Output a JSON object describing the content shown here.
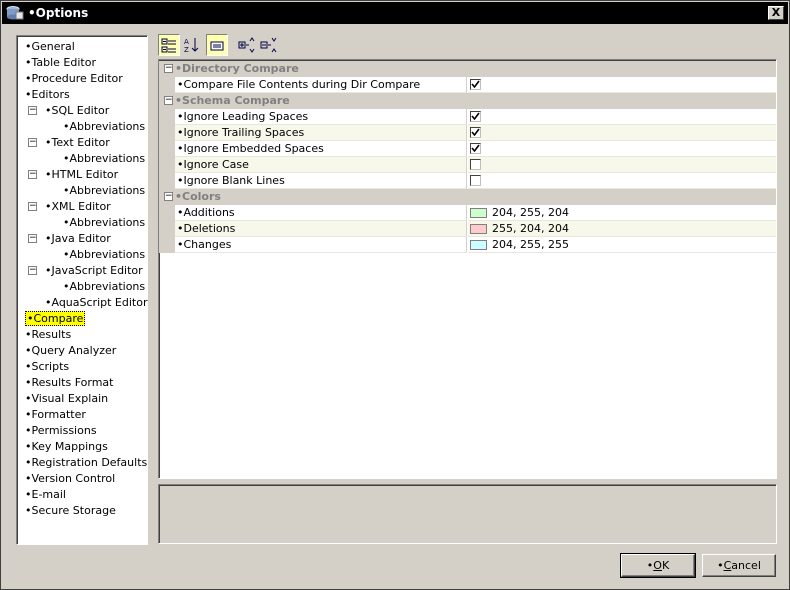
{
  "window": {
    "title": "•Options",
    "close_label": "X"
  },
  "tree": [
    {
      "label": "•General"
    },
    {
      "label": "•Table Editor"
    },
    {
      "label": "•Procedure Editor"
    },
    {
      "label": "•Editors"
    },
    {
      "label": "•SQL Editor",
      "expander": "−"
    },
    {
      "label": "•Abbreviations"
    },
    {
      "label": "•Text Editor",
      "expander": "−"
    },
    {
      "label": "•Abbreviations"
    },
    {
      "label": "•HTML Editor",
      "expander": "−"
    },
    {
      "label": "•Abbreviations"
    },
    {
      "label": "•XML Editor",
      "expander": "−"
    },
    {
      "label": "•Abbreviations"
    },
    {
      "label": "•Java Editor",
      "expander": "−"
    },
    {
      "label": "•Abbreviations"
    },
    {
      "label": "•JavaScript Editor",
      "expander": "−"
    },
    {
      "label": "•Abbreviations"
    },
    {
      "label": "•AquaScript Editor"
    },
    {
      "label": "•Compare",
      "selected": true
    },
    {
      "label": "•Results"
    },
    {
      "label": "•Query Analyzer"
    },
    {
      "label": "•Scripts"
    },
    {
      "label": "•Results Format"
    },
    {
      "label": "•Visual Explain"
    },
    {
      "label": "•Formatter"
    },
    {
      "label": "•Permissions"
    },
    {
      "label": "•Key Mappings"
    },
    {
      "label": "•Registration Defaults"
    },
    {
      "label": "•Version Control"
    },
    {
      "label": "•E-mail"
    },
    {
      "label": "•Secure Storage"
    }
  ],
  "toolbar": {
    "categorized": "categorized-view-icon",
    "alphabetical": "sort-alphabetical-icon",
    "description": "show-description-icon",
    "expand_all": "expand-all-icon",
    "collapse_all": "collapse-all-icon"
  },
  "properties": {
    "dir_compare": {
      "category": "•Directory Compare",
      "rows": [
        {
          "name": "•Compare File Contents during Dir Compare",
          "checked": true
        }
      ]
    },
    "schema_compare": {
      "category": "•Schema Compare",
      "rows": [
        {
          "name": "•Ignore Leading Spaces",
          "checked": true
        },
        {
          "name": "•Ignore Trailing Spaces",
          "checked": true
        },
        {
          "name": "•Ignore Embedded Spaces",
          "checked": true
        },
        {
          "name": "•Ignore Case",
          "checked": false
        },
        {
          "name": "•Ignore Blank Lines",
          "checked": false
        }
      ]
    },
    "colors": {
      "category": "•Colors",
      "rows": [
        {
          "name": "•Additions",
          "value": "204, 255, 204",
          "color": "#ccffcc"
        },
        {
          "name": "•Deletions",
          "value": "255, 204, 204",
          "color": "#ffcccc"
        },
        {
          "name": "•Changes",
          "value": "204, 255, 255",
          "color": "#ccffff"
        }
      ]
    }
  },
  "buttons": {
    "ok_prefix": "•",
    "ok_mnemonic": "O",
    "ok_rest": "K",
    "cancel_prefix": "•",
    "cancel_mnemonic": "C",
    "cancel_rest": "ancel"
  }
}
